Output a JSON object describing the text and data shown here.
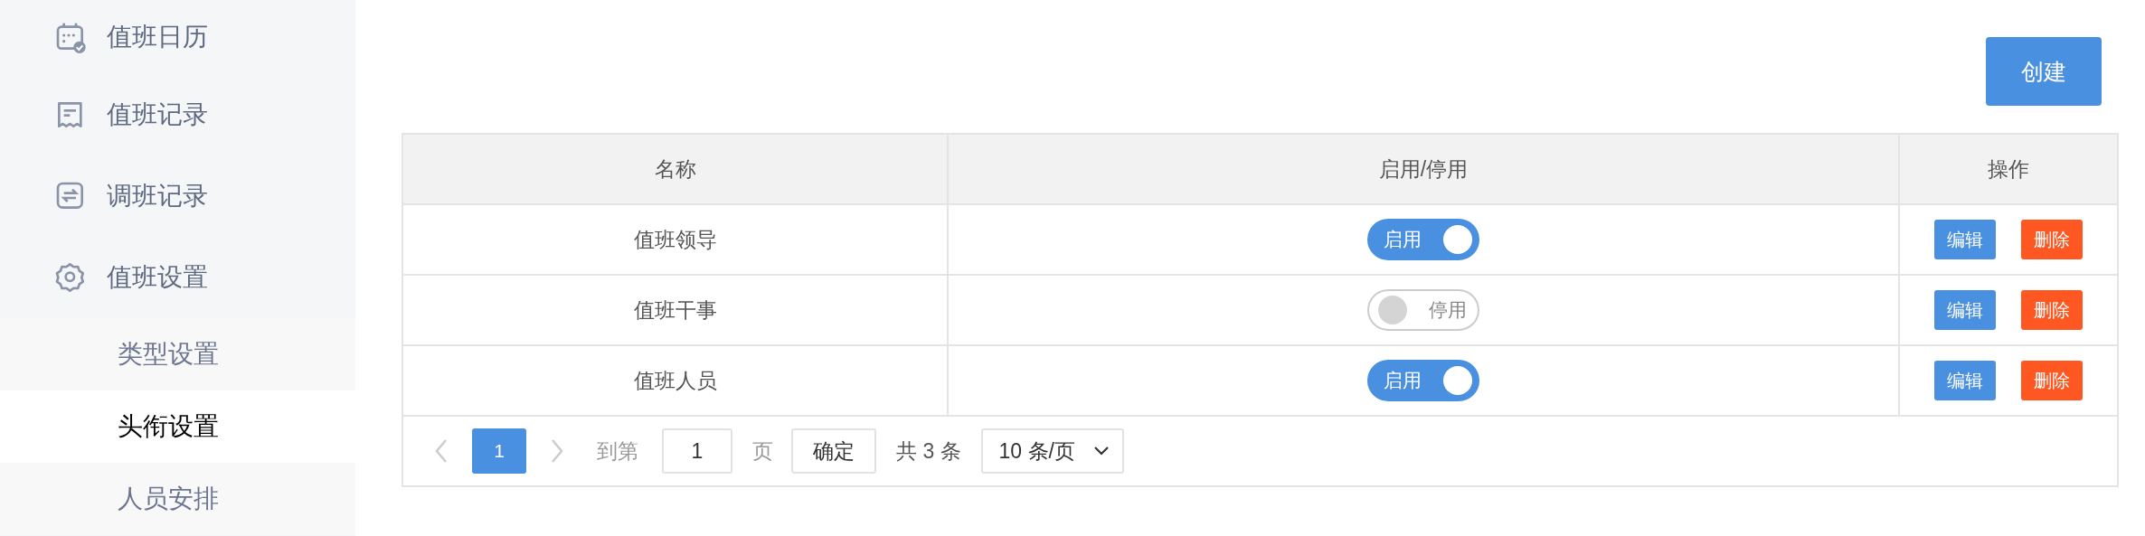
{
  "sidebar": {
    "items": [
      {
        "label": "值班日历",
        "kind": "calendar",
        "selected": false
      },
      {
        "label": "值班记录",
        "kind": "receipt",
        "selected": false
      },
      {
        "label": "调班记录",
        "kind": "swap",
        "selected": false
      },
      {
        "label": "值班设置",
        "kind": "gear",
        "selected": false,
        "children": [
          {
            "label": "类型设置",
            "selected": false
          },
          {
            "label": "头衔设置",
            "selected": true
          },
          {
            "label": "人员安排",
            "selected": false
          }
        ]
      }
    ]
  },
  "create_button": "创建",
  "table": {
    "columns": [
      "名称",
      "启用/停用",
      "操作"
    ],
    "rows": [
      {
        "name": "值班领导",
        "status": {
          "on": true,
          "label": "启用"
        },
        "actions": [
          "编辑",
          "删除"
        ]
      },
      {
        "name": "值班干事",
        "status": {
          "on": false,
          "label": "停用"
        },
        "actions": [
          "编辑",
          "删除"
        ]
      },
      {
        "name": "值班人员",
        "status": {
          "on": true,
          "label": "启用"
        },
        "actions": [
          "编辑",
          "删除"
        ]
      }
    ]
  },
  "pagination": {
    "pages": [
      {
        "label": "1",
        "selected": true
      }
    ],
    "goto_label": "到第",
    "goto_value": "1",
    "page_unit": "页",
    "confirm": "确定",
    "total": "共 3 条",
    "page_size": "10 条/页"
  }
}
